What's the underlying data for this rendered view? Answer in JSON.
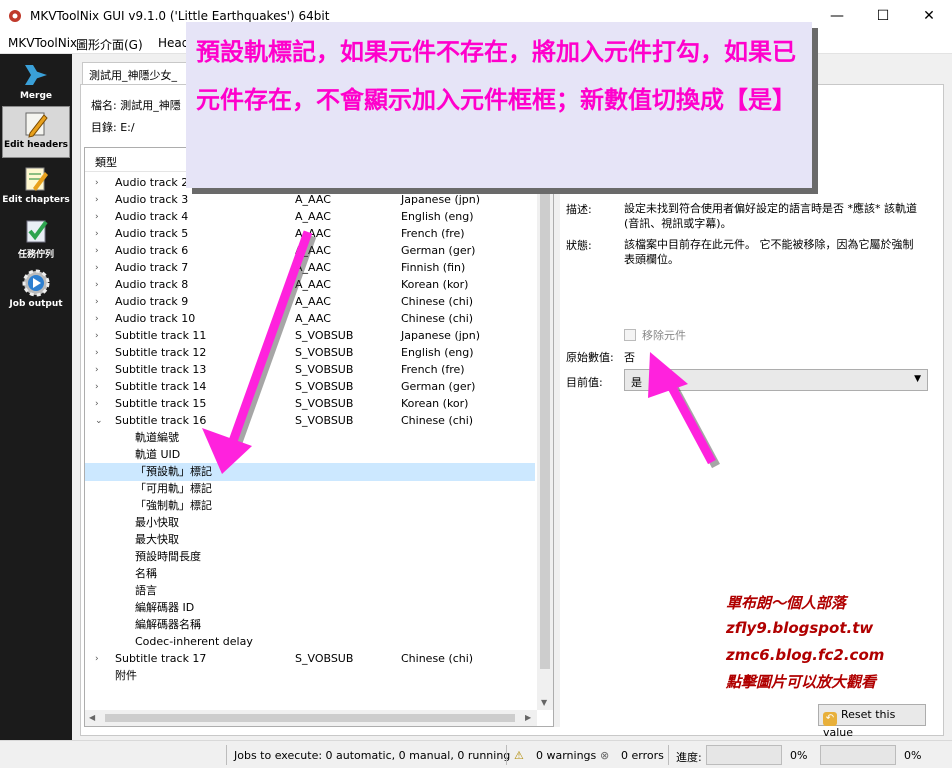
{
  "window": {
    "title": "MKVToolNix GUI v9.1.0 ('Little Earthquakes') 64bit",
    "minimize": "—",
    "maximize": "☐",
    "close": "✕"
  },
  "menu": [
    "MKVToolNix",
    "圖形介面(G)",
    "Head"
  ],
  "sidebar": [
    {
      "label": "Merge",
      "icon": "merge-icon"
    },
    {
      "label": "Edit headers",
      "icon": "pencil-icon"
    },
    {
      "label": "Edit chapters",
      "icon": "notepad-icon"
    },
    {
      "label": "任務佇列",
      "icon": "checklist-icon"
    },
    {
      "label": "Job output",
      "icon": "gear-play-icon"
    }
  ],
  "tab": {
    "label": "測試用_神隱少女_"
  },
  "file": {
    "name_label": "檔名:",
    "name_value": "測試用_神隱",
    "dir_label": "目錄:",
    "dir_value": "E:/"
  },
  "tree": {
    "header": "類型",
    "rows": [
      {
        "arrow": "›",
        "name": "Audio track 2",
        "codec": "",
        "lang": "",
        "child": false,
        "sel": false
      },
      {
        "arrow": "›",
        "name": "Audio track 3",
        "codec": "A_AAC",
        "lang": "Japanese (jpn)",
        "child": false,
        "sel": false
      },
      {
        "arrow": "›",
        "name": "Audio track 4",
        "codec": "A_AAC",
        "lang": "English (eng)",
        "child": false,
        "sel": false
      },
      {
        "arrow": "›",
        "name": "Audio track 5",
        "codec": "A_AAC",
        "lang": "French (fre)",
        "child": false,
        "sel": false
      },
      {
        "arrow": "›",
        "name": "Audio track 6",
        "codec": "A_AAC",
        "lang": "German (ger)",
        "child": false,
        "sel": false
      },
      {
        "arrow": "›",
        "name": "Audio track 7",
        "codec": "A_AAC",
        "lang": "Finnish (fin)",
        "child": false,
        "sel": false
      },
      {
        "arrow": "›",
        "name": "Audio track 8",
        "codec": "A_AAC",
        "lang": "Korean (kor)",
        "child": false,
        "sel": false
      },
      {
        "arrow": "›",
        "name": "Audio track 9",
        "codec": "A_AAC",
        "lang": "Chinese (chi)",
        "child": false,
        "sel": false
      },
      {
        "arrow": "›",
        "name": "Audio track 10",
        "codec": "A_AAC",
        "lang": "Chinese (chi)",
        "child": false,
        "sel": false
      },
      {
        "arrow": "›",
        "name": "Subtitle track 11",
        "codec": "S_VOBSUB",
        "lang": "Japanese (jpn)",
        "child": false,
        "sel": false
      },
      {
        "arrow": "›",
        "name": "Subtitle track 12",
        "codec": "S_VOBSUB",
        "lang": "English (eng)",
        "child": false,
        "sel": false
      },
      {
        "arrow": "›",
        "name": "Subtitle track 13",
        "codec": "S_VOBSUB",
        "lang": "French (fre)",
        "child": false,
        "sel": false
      },
      {
        "arrow": "›",
        "name": "Subtitle track 14",
        "codec": "S_VOBSUB",
        "lang": "German (ger)",
        "child": false,
        "sel": false
      },
      {
        "arrow": "›",
        "name": "Subtitle track 15",
        "codec": "S_VOBSUB",
        "lang": "Korean (kor)",
        "child": false,
        "sel": false
      },
      {
        "arrow": "⌄",
        "name": "Subtitle track 16",
        "codec": "S_VOBSUB",
        "lang": "Chinese (chi)",
        "child": false,
        "sel": false
      },
      {
        "arrow": "",
        "name": "軌道編號",
        "codec": "",
        "lang": "",
        "child": true,
        "sel": false
      },
      {
        "arrow": "",
        "name": "軌道 UID",
        "codec": "",
        "lang": "",
        "child": true,
        "sel": false
      },
      {
        "arrow": "",
        "name": "「預設軌」標記",
        "codec": "",
        "lang": "",
        "child": true,
        "sel": true
      },
      {
        "arrow": "",
        "name": "「可用軌」標記",
        "codec": "",
        "lang": "",
        "child": true,
        "sel": false
      },
      {
        "arrow": "",
        "name": "「強制軌」標記",
        "codec": "",
        "lang": "",
        "child": true,
        "sel": false
      },
      {
        "arrow": "",
        "name": "最小快取",
        "codec": "",
        "lang": "",
        "child": true,
        "sel": false
      },
      {
        "arrow": "",
        "name": "最大快取",
        "codec": "",
        "lang": "",
        "child": true,
        "sel": false
      },
      {
        "arrow": "",
        "name": "預設時間長度",
        "codec": "",
        "lang": "",
        "child": true,
        "sel": false
      },
      {
        "arrow": "",
        "name": "名稱",
        "codec": "",
        "lang": "",
        "child": true,
        "sel": false
      },
      {
        "arrow": "",
        "name": "語言",
        "codec": "",
        "lang": "",
        "child": true,
        "sel": false
      },
      {
        "arrow": "",
        "name": "編解碼器 ID",
        "codec": "",
        "lang": "",
        "child": true,
        "sel": false
      },
      {
        "arrow": "",
        "name": "編解碼器名稱",
        "codec": "",
        "lang": "",
        "child": true,
        "sel": false
      },
      {
        "arrow": "",
        "name": "Codec-inherent delay",
        "codec": "",
        "lang": "",
        "child": true,
        "sel": false
      },
      {
        "arrow": "›",
        "name": "Subtitle track 17",
        "codec": "S_VOBSUB",
        "lang": "Chinese (chi)",
        "child": false,
        "sel": false
      },
      {
        "arrow": "",
        "name": "附件",
        "codec": "",
        "lang": "",
        "child": false,
        "sel": false
      }
    ]
  },
  "details": {
    "desc_label": "描述:",
    "desc_text": "設定未找到符合使用者偏好設定的語言時是否 *應該* 該軌道 (音訊、視訊或字幕)。",
    "status_label": "狀態:",
    "status_text": "該檔案中目前存在此元件。 它不能被移除，因為它屬於強制表頭欄位。",
    "remove_label": "移除元件",
    "orig_label": "原始數值:",
    "orig_value": "否",
    "current_label": "目前值:",
    "current_value": "是",
    "reset_label": "Reset this value"
  },
  "callout": {
    "text": "預設軌標記，如果元件不存在，將加入元件打勾，如果已元件存在，不會顯示加入元件框框；新數值切換成【是】"
  },
  "watermark": [
    "單布朗～個人部落",
    "zfly9.blogspot.tw",
    "zmc6.blog.fc2.com",
    "點擊圖片可以放大觀看"
  ],
  "status": {
    "jobs": "Jobs to execute: 0 automatic, 0 manual, 0 running",
    "warnings": "0 warnings",
    "errors": "0 errors",
    "progress_label": "進度:",
    "progress1": "0%",
    "progress2": "0%"
  },
  "colors": {
    "accent_magenta": "#ff00cc",
    "selection": "#cce8ff",
    "sidebar_bg": "#1b1b1b",
    "watermark": "#b00000"
  }
}
